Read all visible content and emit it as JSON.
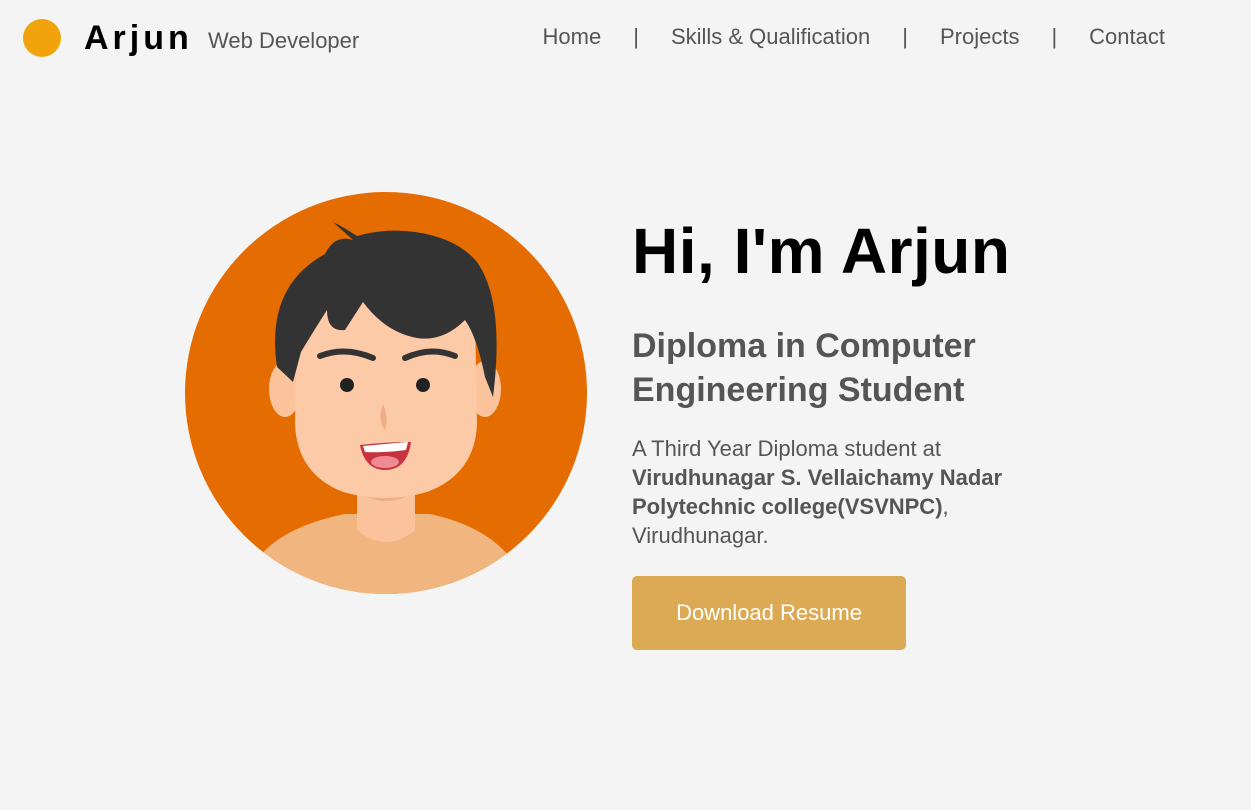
{
  "header": {
    "brand_name": "Arjun",
    "brand_role": "Web Developer",
    "logo_color": "#f0a30a",
    "nav": [
      {
        "label": "Home"
      },
      {
        "label": "Skills & Qualification"
      },
      {
        "label": "Projects"
      },
      {
        "label": "Contact"
      }
    ],
    "nav_separator": "|"
  },
  "hero": {
    "title": "Hi, I'm Arjun",
    "subtitle": "Diploma in Computer Engineering Student",
    "desc_prefix": "A Third Year Diploma student at ",
    "desc_institution": "Virudhunagar S. Vellaichamy Nadar Polytechnic college(VSVNPC)",
    "desc_suffix": ", Virudhunagar.",
    "avatar_icon": "boy-avatar-illustration",
    "avatar_bg_color": "#e56c00",
    "button_label": "Download Resume",
    "button_color": "#dca954"
  }
}
